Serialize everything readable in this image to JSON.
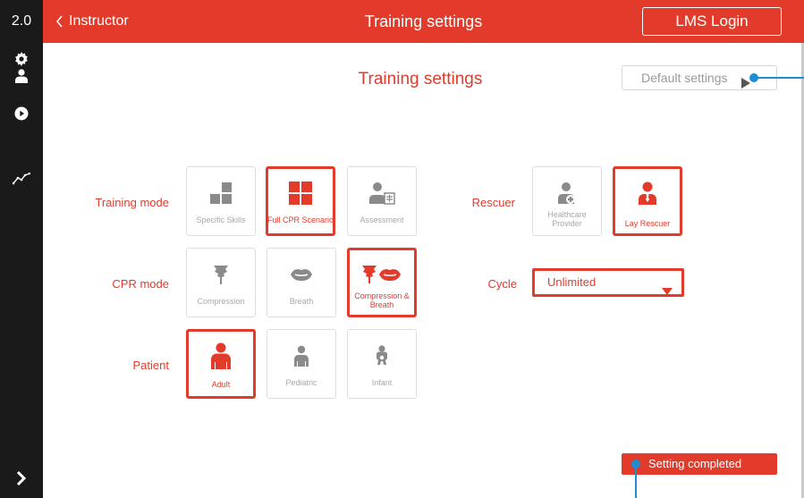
{
  "sidebar": {
    "version": "2.0",
    "icons": [
      "gear-icon",
      "user-icon",
      "play-icon",
      "trend-icon"
    ],
    "expand_icon": "chevron-right-icon"
  },
  "topbar": {
    "back_label": "Instructor",
    "title": "Training settings",
    "lms_label": "LMS Login"
  },
  "main": {
    "title": "Training settings",
    "default_button_label": "Default settings"
  },
  "training_mode": {
    "label": "Training mode",
    "options": [
      {
        "label": "Specific Skills",
        "selected": false
      },
      {
        "label": "Full CPR Scenario",
        "selected": true
      },
      {
        "label": "Assessment",
        "selected": false
      }
    ]
  },
  "cpr_mode": {
    "label": "CPR mode",
    "options": [
      {
        "label": "Compression",
        "selected": false
      },
      {
        "label": "Breath",
        "selected": false
      },
      {
        "label": "Compression & Breath",
        "selected": true
      }
    ]
  },
  "patient": {
    "label": "Patient",
    "options": [
      {
        "label": "Adult",
        "selected": true
      },
      {
        "label": "Pediatric",
        "selected": false
      },
      {
        "label": "Infant",
        "selected": false
      }
    ]
  },
  "rescuer": {
    "label": "Rescuer",
    "options": [
      {
        "label": "Healthcare Provider",
        "selected": false
      },
      {
        "label": "Lay Rescuer",
        "selected": true
      }
    ]
  },
  "cycle": {
    "label": "Cycle",
    "value": "Unlimited"
  },
  "status": {
    "completed_label": "Setting completed"
  },
  "colors": {
    "accent": "#e23b2b",
    "sidebar": "#1a1a1a",
    "inactive_icon": "#8a8a8a",
    "inactive_text": "#a8a8a8",
    "callout": "#1d8fd1"
  }
}
